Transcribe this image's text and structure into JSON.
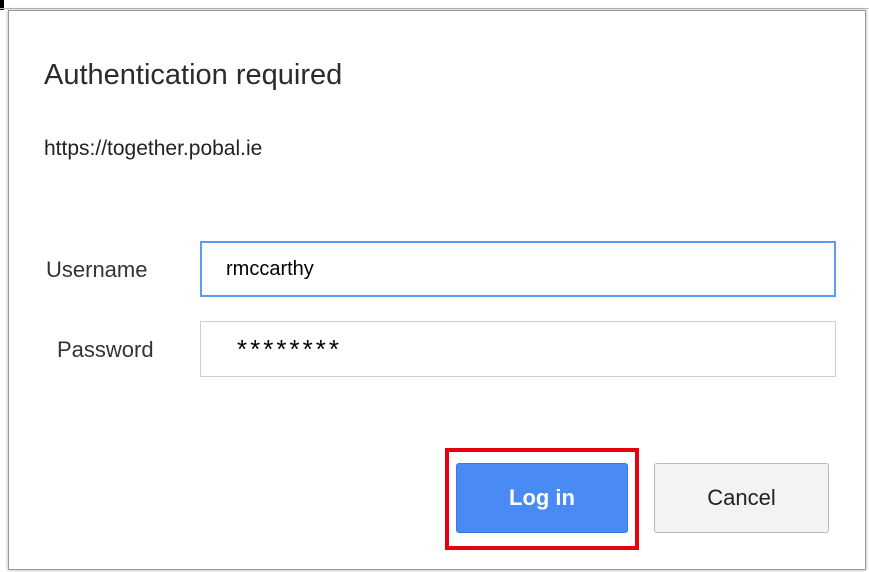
{
  "dialog": {
    "title": "Authentication required",
    "origin": "https://together.pobal.ie"
  },
  "form": {
    "username_label": "Username",
    "username_value": "rmccarthy",
    "password_label": "Password",
    "password_value": "********"
  },
  "buttons": {
    "login_label": "Log in",
    "cancel_label": "Cancel"
  },
  "colors": {
    "login_button": "#4a8af4",
    "focus_border": "#5b9cf6",
    "highlight_box": "#e8000d"
  }
}
